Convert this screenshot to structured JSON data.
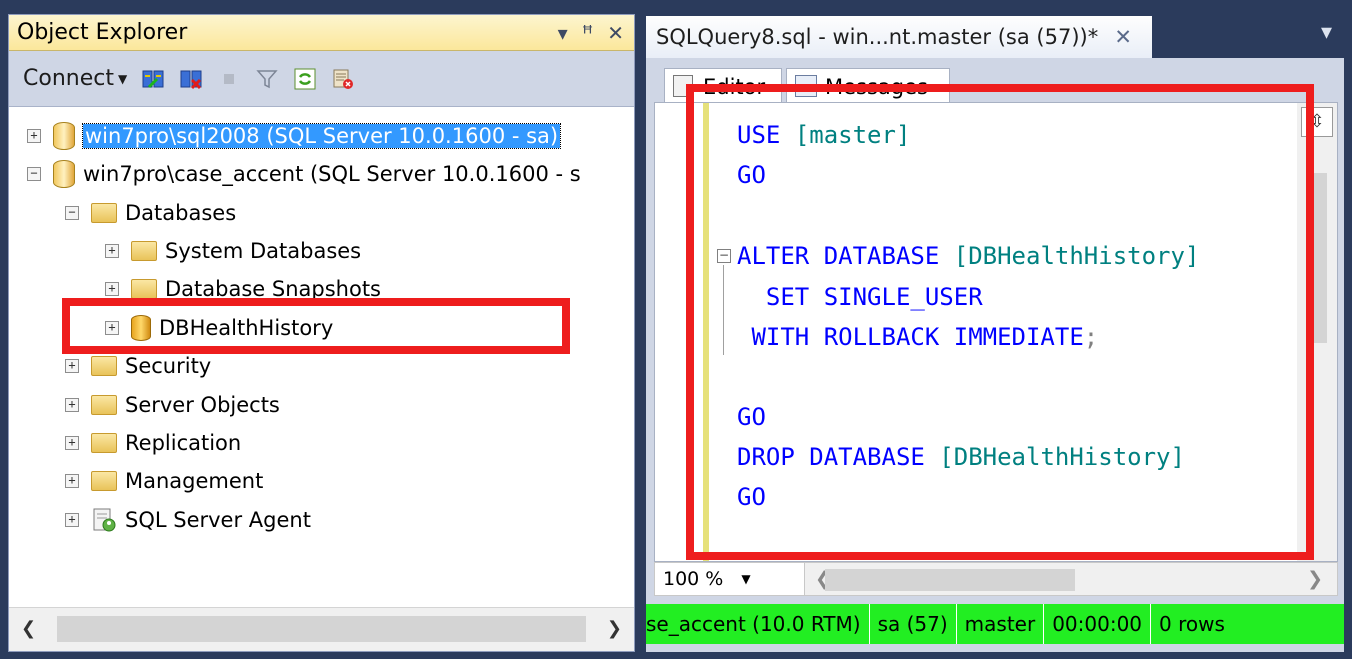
{
  "object_explorer": {
    "title": "Object Explorer",
    "controls": [
      "▾",
      "ꟸ",
      "✕"
    ],
    "connect_label": "Connect",
    "tree": {
      "server1": "win7pro\\sql2008 (SQL Server 10.0.1600 - sa)",
      "server2": "win7pro\\case_accent (SQL Server 10.0.1600 - s",
      "databases": "Databases",
      "system_databases": "System Databases",
      "database_snapshots": "Database Snapshots",
      "dbhealthhistory": "DBHealthHistory",
      "security": "Security",
      "server_objects": "Server Objects",
      "replication": "Replication",
      "management": "Management",
      "sql_server_agent": "SQL Server Agent"
    },
    "expanders": {
      "plus": "+",
      "minus": "−"
    }
  },
  "query_tab": {
    "title": "SQLQuery8.sql - win...nt.master (sa (57))*",
    "close": "✕",
    "dropdown": "▾",
    "subtabs": [
      "Editor",
      "Messages"
    ]
  },
  "code_lines": [
    {
      "kw": "USE",
      "sp": " ",
      "id": "[master]",
      "p": ""
    },
    {
      "kw": "GO",
      "sp": "",
      "id": "",
      "p": ""
    },
    {
      "kw": "",
      "sp": "",
      "id": "",
      "p": ""
    },
    {
      "kw": "ALTER DATABASE",
      "sp": " ",
      "id": "[DBHealthHistory]",
      "p": ""
    },
    {
      "kw": "  SET SINGLE_USER",
      "sp": "",
      "id": "",
      "p": ""
    },
    {
      "kw": " WITH ROLLBACK IMMEDIATE",
      "sp": "",
      "id": "",
      "p": ";"
    },
    {
      "kw": "",
      "sp": "",
      "id": "",
      "p": ""
    },
    {
      "kw": "GO",
      "sp": "",
      "id": "",
      "p": ""
    },
    {
      "kw": "DROP DATABASE",
      "sp": " ",
      "id": "[DBHealthHistory]",
      "p": ""
    },
    {
      "kw": "GO",
      "sp": "",
      "id": "",
      "p": ""
    }
  ],
  "editor_bottom": {
    "zoom": "100 %"
  },
  "status_bar": {
    "segments": [
      "se_accent (10.0 RTM)",
      "sa (57)",
      "master",
      "00:00:00",
      "0 rows"
    ]
  },
  "colors": {
    "status_bg": "#22ee22",
    "highlight_box": "#ee1d1d",
    "selection": "#3399ff"
  }
}
